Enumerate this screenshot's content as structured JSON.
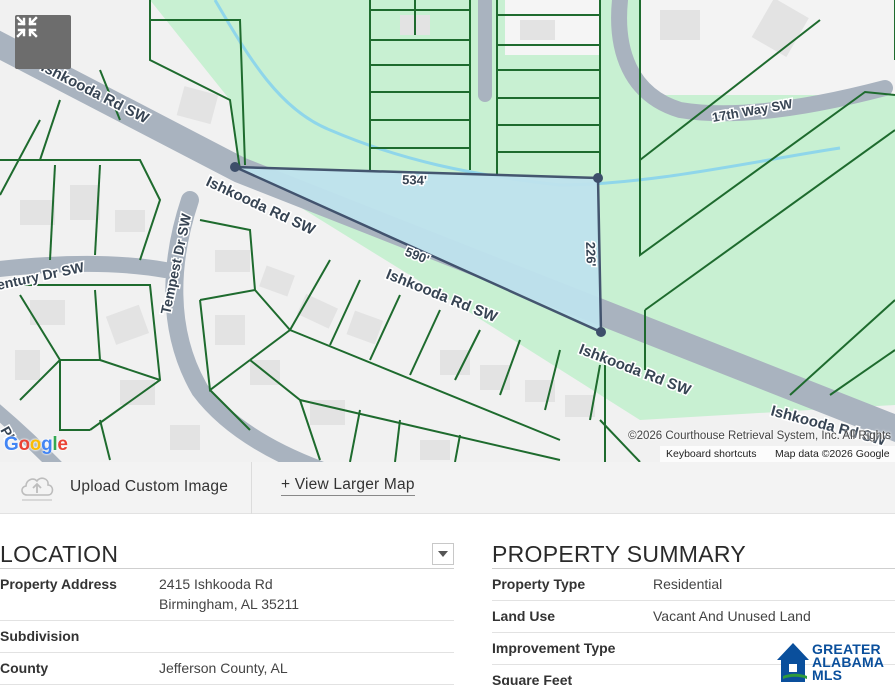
{
  "map": {
    "streets": {
      "ishkooda_1": "Ishkooda Rd SW",
      "ishkooda_2": "Ishkooda Rd SW",
      "ishkooda_3": "Ishkooda Rd SW",
      "ishkooda_4": "Ishkooda Rd SW",
      "ishkooda_5": "Ishkooda Rd SW",
      "seventeenth_way": "17th Way SW",
      "tempest": "Tempest Dr SW",
      "century": "entury Dr SW",
      "partial_left": "Pl"
    },
    "dimensions": {
      "top": "534'",
      "diagonal": "590'",
      "right": "226'"
    },
    "collapse_icon": "collapse-arrows-icon",
    "google_logo": [
      "G",
      "o",
      "o",
      "g",
      "l",
      "e"
    ],
    "google_colors": [
      "#4285F4",
      "#EA4335",
      "#FBBC05",
      "#4285F4",
      "#34A853",
      "#EA4335"
    ],
    "copyright": "©2026 Courthouse Retrieval System, Inc. All Rights",
    "keyboard_shortcuts": "Keyboard shortcuts",
    "map_data": "Map data ©2026 Google",
    "colors": {
      "parcel_fill": "#bfe3ee",
      "parcel_stroke": "#3d4e6a",
      "green_area": "#c8f0d2",
      "lot_line": "#1e6b2e",
      "road": "#aab5c2"
    }
  },
  "toolbar": {
    "upload_icon": "cloud-upload-icon",
    "upload_label": "Upload Custom Image",
    "view_larger_label": "+ View Larger Map"
  },
  "location": {
    "title": "LOCATION",
    "dropdown_icon": "caret-down-icon",
    "rows": [
      {
        "label": "Property Address",
        "value": "2415 Ishkooda Rd",
        "value2": "Birmingham, AL 35211"
      },
      {
        "label": "Subdivision",
        "value": ""
      },
      {
        "label": "County",
        "value": "Jefferson County, AL"
      }
    ]
  },
  "summary": {
    "title": "PROPERTY SUMMARY",
    "rows": [
      {
        "label": "Property Type",
        "value": "Residential"
      },
      {
        "label": "Land Use",
        "value": "Vacant And Unused Land"
      },
      {
        "label": "Improvement Type",
        "value": ""
      },
      {
        "label": "Square Feet",
        "value": ""
      }
    ]
  },
  "brand": {
    "line1": "GREATER",
    "line2": "ALABAMA",
    "line3": "MLS",
    "color": "#0a4f9c",
    "accent": "#2e9a3c"
  }
}
